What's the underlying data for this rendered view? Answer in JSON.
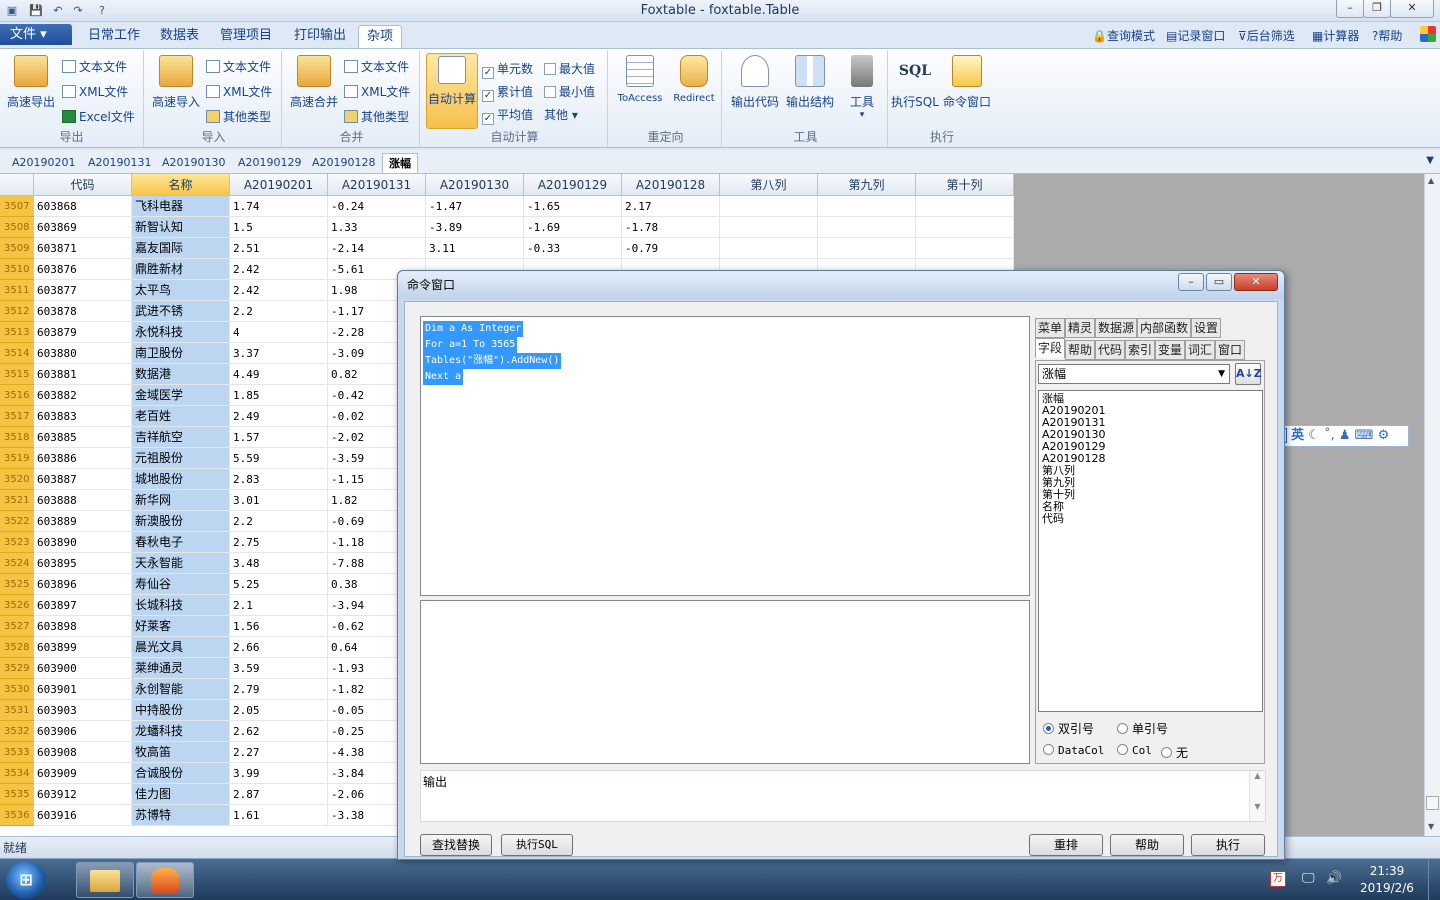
{
  "window": {
    "title": "Foxtable - foxtable.Table"
  },
  "menu": {
    "file": "文件",
    "tabs": [
      "日常工作",
      "数据表",
      "管理项目",
      "打印输出",
      "杂项"
    ],
    "right_links": [
      "查询模式",
      "记录窗口",
      "后台筛选",
      "计算器",
      "帮助"
    ]
  },
  "ribbon": {
    "groups": {
      "export": "导出",
      "import": "导入",
      "merge": "合并",
      "autocalc": "自动计算",
      "redirect": "重定向",
      "tools": "工具",
      "execute": "执行"
    },
    "export": {
      "big": "高速导出",
      "text": "文本文件",
      "xml": "XML文件",
      "excel": "Excel文件"
    },
    "import": {
      "big": "高速导入",
      "text": "文本文件",
      "xml": "XML文件",
      "other": "其他类型"
    },
    "merge": {
      "big": "高速合并",
      "text": "文本文件",
      "xml": "XML文件",
      "other": "其他类型"
    },
    "autocalc": {
      "big": "自动计算",
      "cells": "单元数",
      "max": "最大值",
      "cumulative": "累计值",
      "min": "最小值",
      "avg": "平均值",
      "other": "其他"
    },
    "redirect": {
      "toaccess": "ToAccess",
      "redirect": "Redirect"
    },
    "tools": {
      "outcode": "输出代码",
      "outstruct": "输出结构",
      "tool": "工具"
    },
    "execute": {
      "sql": "执行SQL",
      "cmdwin": "命令窗口",
      "sql_icon": "SQL"
    }
  },
  "sheet_tabs": [
    "A20190201",
    "A20190131",
    "A20190130",
    "A20190129",
    "A20190128",
    "涨幅"
  ],
  "grid": {
    "columns": [
      "代码",
      "名称",
      "A20190201",
      "A20190131",
      "A20190130",
      "A20190129",
      "A20190128",
      "第八列",
      "第九列",
      "第十列"
    ],
    "rows": [
      {
        "n": "3507",
        "cells": [
          "603868",
          "飞科电器",
          "1.74",
          "-0.24",
          "-1.47",
          "-1.65",
          "2.17"
        ]
      },
      {
        "n": "3508",
        "cells": [
          "603869",
          "新智认知",
          "1.5",
          "1.33",
          "-3.89",
          "-1.69",
          "-1.78"
        ]
      },
      {
        "n": "3509",
        "cells": [
          "603871",
          "嘉友国际",
          "2.51",
          "-2.14",
          "3.11",
          "-0.33",
          "-0.79"
        ]
      },
      {
        "n": "3510",
        "cells": [
          "603876",
          "鼎胜新材",
          "2.42",
          "-5.61",
          "",
          "",
          ""
        ]
      },
      {
        "n": "3511",
        "cells": [
          "603877",
          "太平鸟",
          "2.42",
          "1.98",
          "",
          "",
          ""
        ]
      },
      {
        "n": "3512",
        "cells": [
          "603878",
          "武进不锈",
          "2.2",
          "-1.17",
          "",
          "",
          ""
        ]
      },
      {
        "n": "3513",
        "cells": [
          "603879",
          "永悦科技",
          "4",
          "-2.28",
          "",
          "",
          ""
        ]
      },
      {
        "n": "3514",
        "cells": [
          "603880",
          "南卫股份",
          "3.37",
          "-3.09",
          "",
          "",
          ""
        ]
      },
      {
        "n": "3515",
        "cells": [
          "603881",
          "数据港",
          "4.49",
          "0.82",
          "",
          "",
          ""
        ]
      },
      {
        "n": "3516",
        "cells": [
          "603882",
          "金域医学",
          "1.85",
          "-0.42",
          "",
          "",
          ""
        ]
      },
      {
        "n": "3517",
        "cells": [
          "603883",
          "老百姓",
          "2.49",
          "-0.02",
          "",
          "",
          ""
        ]
      },
      {
        "n": "3518",
        "cells": [
          "603885",
          "吉祥航空",
          "1.57",
          "-2.02",
          "",
          "",
          ""
        ]
      },
      {
        "n": "3519",
        "cells": [
          "603886",
          "元祖股份",
          "5.59",
          "-3.59",
          "",
          "",
          ""
        ]
      },
      {
        "n": "3520",
        "cells": [
          "603887",
          "城地股份",
          "2.83",
          "-1.15",
          "",
          "",
          ""
        ]
      },
      {
        "n": "3521",
        "cells": [
          "603888",
          "新华网",
          "3.01",
          "1.82",
          "",
          "",
          ""
        ]
      },
      {
        "n": "3522",
        "cells": [
          "603889",
          "新澳股份",
          "2.2",
          "-0.69",
          "",
          "",
          ""
        ]
      },
      {
        "n": "3523",
        "cells": [
          "603890",
          "春秋电子",
          "2.75",
          "-1.18",
          "",
          "",
          ""
        ]
      },
      {
        "n": "3524",
        "cells": [
          "603895",
          "天永智能",
          "3.48",
          "-7.88",
          "",
          "",
          ""
        ]
      },
      {
        "n": "3525",
        "cells": [
          "603896",
          "寿仙谷",
          "5.25",
          "0.38",
          "",
          "",
          ""
        ]
      },
      {
        "n": "3526",
        "cells": [
          "603897",
          "长城科技",
          "2.1",
          "-3.94",
          "",
          "",
          ""
        ]
      },
      {
        "n": "3527",
        "cells": [
          "603898",
          "好莱客",
          "1.56",
          "-0.62",
          "",
          "",
          ""
        ]
      },
      {
        "n": "3528",
        "cells": [
          "603899",
          "晨光文具",
          "2.66",
          "0.64",
          "",
          "",
          ""
        ]
      },
      {
        "n": "3529",
        "cells": [
          "603900",
          "莱绅通灵",
          "3.59",
          "-1.93",
          "",
          "",
          ""
        ]
      },
      {
        "n": "3530",
        "cells": [
          "603901",
          "永创智能",
          "2.79",
          "-1.82",
          "",
          "",
          ""
        ]
      },
      {
        "n": "3531",
        "cells": [
          "603903",
          "中持股份",
          "2.05",
          "-0.05",
          "",
          "",
          ""
        ]
      },
      {
        "n": "3532",
        "cells": [
          "603906",
          "龙蟠科技",
          "2.62",
          "-0.25",
          "",
          "",
          ""
        ]
      },
      {
        "n": "3533",
        "cells": [
          "603908",
          "牧高笛",
          "2.27",
          "-4.38",
          "",
          "",
          ""
        ]
      },
      {
        "n": "3534",
        "cells": [
          "603909",
          "合诚股份",
          "3.99",
          "-3.84",
          "",
          "",
          ""
        ]
      },
      {
        "n": "3535",
        "cells": [
          "603912",
          "佳力图",
          "2.87",
          "-2.06",
          "",
          "",
          ""
        ]
      },
      {
        "n": "3536",
        "cells": [
          "603916",
          "苏博特",
          "1.61",
          "-3.38",
          "",
          "",
          ""
        ]
      }
    ]
  },
  "status": "就绪",
  "dialog": {
    "title": "命令窗口",
    "code_lines": [
      "Dim a As Integer",
      "For a=1 To 3565",
      "Tables(\"涨幅\").AddNew()",
      "Next a"
    ],
    "output_label": "输出",
    "panel_tabs_row1": [
      "菜单",
      "精灵",
      "数据源",
      "内部函数",
      "设置"
    ],
    "panel_tabs_row2": [
      "字段",
      "帮助",
      "代码",
      "索引",
      "变量",
      "词汇",
      "窗口"
    ],
    "table_select": "涨幅",
    "sort_label": "A↓Z",
    "fields": [
      "涨幅",
      "A20190201",
      "A20190131",
      "A20190130",
      "A20190129",
      "A20190128",
      "第八列",
      "第九列",
      "第十列",
      "名称",
      "代码"
    ],
    "quote_double": "双引号",
    "quote_single": "单引号",
    "opt_datacol": "DataCol",
    "opt_col": "Col",
    "opt_none": "无",
    "btn_find": "查找替换",
    "btn_sql": "执行SQL",
    "btn_reset": "重排",
    "btn_help": "帮助",
    "btn_run": "执行"
  },
  "ime": {
    "label": "英"
  },
  "taskbar": {
    "time": "21:39",
    "date": "2019/2/6"
  }
}
